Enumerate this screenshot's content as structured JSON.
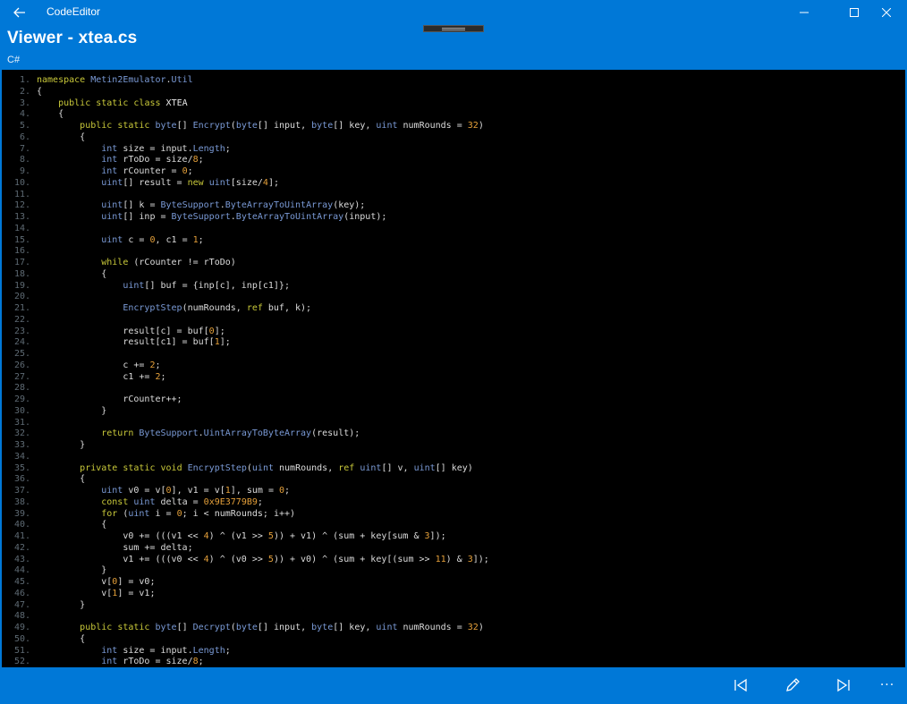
{
  "window": {
    "app_title": "CodeEditor",
    "back_icon": "back-arrow-icon",
    "controls": [
      "minimize-icon",
      "maximize-icon",
      "close-icon"
    ]
  },
  "header": {
    "title": "Viewer - xtea.cs",
    "language": "C#"
  },
  "colors": {
    "accent": "#0078d7",
    "code_background": "#000000",
    "keyword": "#c9c93a",
    "type": "#7a9ad6",
    "number": "#e5a03a",
    "line_number": "#5e6a73"
  },
  "code": {
    "lines": [
      "namespace Metin2Emulator.Util",
      "{",
      "    public static class XTEA",
      "    {",
      "        public static byte[] Encrypt(byte[] input, byte[] key, uint numRounds = 32)",
      "        {",
      "            int size = input.Length;",
      "            int rToDo = size/8;",
      "            int rCounter = 0;",
      "            uint[] result = new uint[size/4];",
      "",
      "            uint[] k = ByteSupport.ByteArrayToUintArray(key);",
      "            uint[] inp = ByteSupport.ByteArrayToUintArray(input);",
      "",
      "            uint c = 0, c1 = 1;",
      "",
      "            while (rCounter != rToDo)",
      "            {",
      "                uint[] buf = {inp[c], inp[c1]};",
      "",
      "                EncryptStep(numRounds, ref buf, k);",
      "",
      "                result[c] = buf[0];",
      "                result[c1] = buf[1];",
      "",
      "                c += 2;",
      "                c1 += 2;",
      "",
      "                rCounter++;",
      "            }",
      "",
      "            return ByteSupport.UintArrayToByteArray(result);",
      "        }",
      "",
      "        private static void EncryptStep(uint numRounds, ref uint[] v, uint[] key)",
      "        {",
      "            uint v0 = v[0], v1 = v[1], sum = 0;",
      "            const uint delta = 0x9E3779B9;",
      "            for (uint i = 0; i < numRounds; i++)",
      "            {",
      "                v0 += (((v1 << 4) ^ (v1 >> 5)) + v1) ^ (sum + key[sum & 3]);",
      "                sum += delta;",
      "                v1 += (((v0 << 4) ^ (v0 >> 5)) + v0) ^ (sum + key[(sum >> 11) & 3]);",
      "            }",
      "            v[0] = v0;",
      "            v[1] = v1;",
      "        }",
      "",
      "        public static byte[] Decrypt(byte[] input, byte[] key, uint numRounds = 32)",
      "        {",
      "            int size = input.Length;",
      "            int rToDo = size/8;"
    ]
  },
  "command_bar": {
    "buttons": [
      "previous-icon",
      "edit-pencil-icon",
      "next-icon",
      "more-icon"
    ],
    "more_label": "···"
  }
}
